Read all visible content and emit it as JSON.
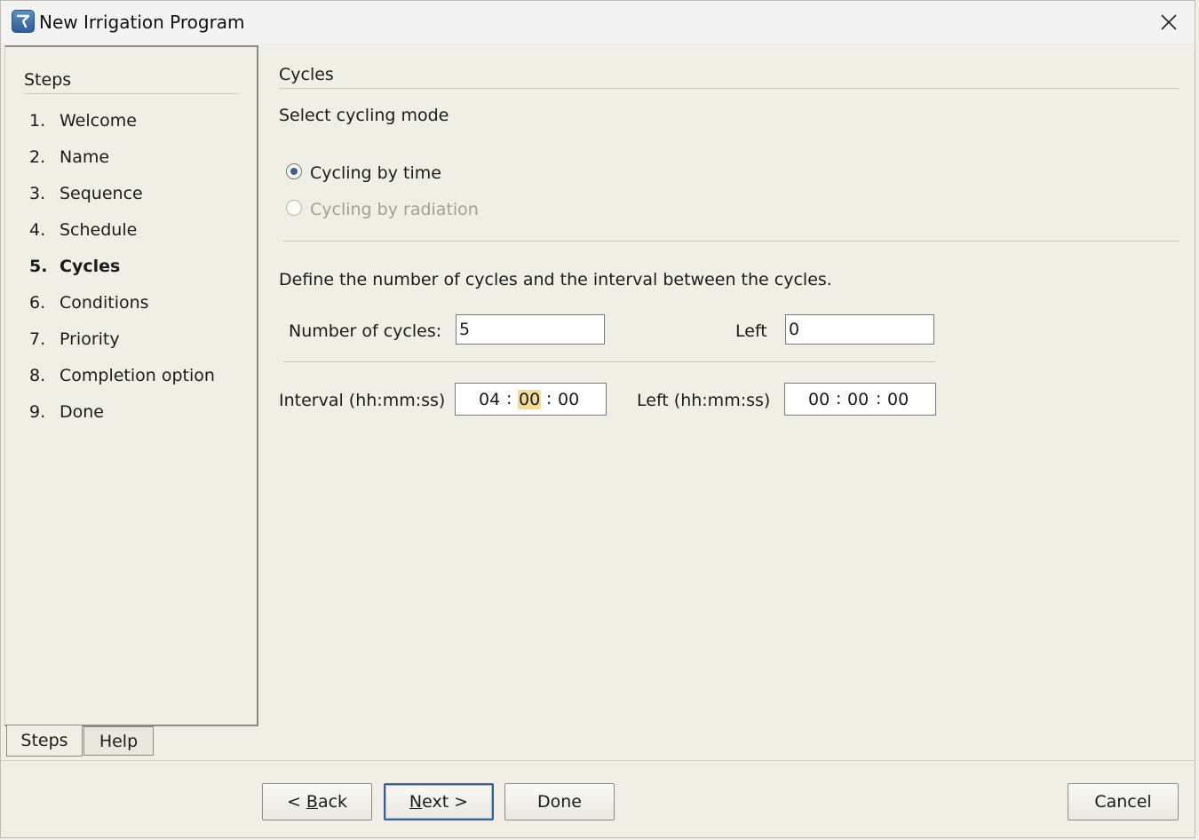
{
  "window": {
    "title": "New Irrigation Program"
  },
  "steps_panel": {
    "heading": "Steps",
    "items": [
      {
        "num": "1.",
        "label": "Welcome"
      },
      {
        "num": "2.",
        "label": "Name"
      },
      {
        "num": "3.",
        "label": "Sequence"
      },
      {
        "num": "4.",
        "label": "Schedule"
      },
      {
        "num": "5.",
        "label": "Cycles",
        "current": true
      },
      {
        "num": "6.",
        "label": "Conditions"
      },
      {
        "num": "7.",
        "label": "Priority"
      },
      {
        "num": "8.",
        "label": "Completion option"
      },
      {
        "num": "9.",
        "label": "Done"
      }
    ],
    "tabs": [
      "Steps",
      "Help"
    ]
  },
  "content": {
    "section_title": "Cycles",
    "mode_prompt": "Select cycling mode",
    "mode_options": [
      {
        "label": "Cycling by time",
        "selected": true,
        "enabled": true
      },
      {
        "label": "Cycling by radiation",
        "selected": false,
        "enabled": false
      }
    ],
    "define_text": "Define the number of cycles and the interval between the cycles.",
    "number_of_cycles_label": "Number of cycles:",
    "number_of_cycles_value": "5",
    "left_label": "Left",
    "left_value": "0",
    "interval_label": "Interval (hh:mm:ss)",
    "interval": {
      "hh": "04",
      "mm": "00",
      "ss": "00"
    },
    "left_time_label": "Left (hh:mm:ss)",
    "left_time": {
      "hh": "00",
      "mm": "00",
      "ss": "00"
    },
    "separator": ":"
  },
  "buttons": {
    "back_prefix": "< ",
    "back_mnemonic": "B",
    "back_rest": "ack",
    "next_mnemonic": "N",
    "next_rest": "ext >",
    "done": "Done",
    "cancel": "Cancel"
  }
}
